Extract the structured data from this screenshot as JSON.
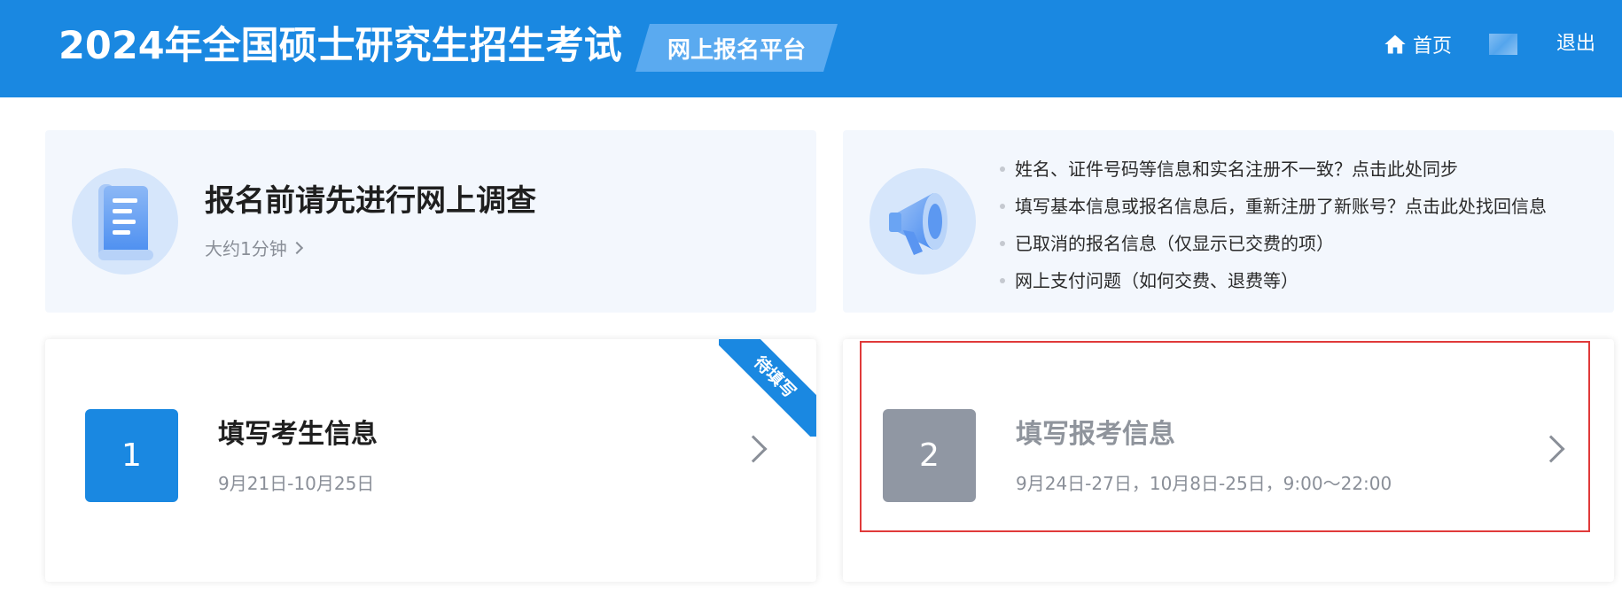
{
  "header": {
    "title": "2024年全国硕士研究生招生考试",
    "platform_badge": "网上报名平台",
    "nav_home": "首页",
    "nav_logout": "退出"
  },
  "survey_card": {
    "title": "报名前请先进行网上调查",
    "subtitle": "大约1分钟",
    "icon": "document-scroll-icon"
  },
  "info_card": {
    "icon": "megaphone-icon",
    "items": [
      "姓名、证件号码等信息和实名注册不一致？点击此处同步",
      "填写基本信息或报名信息后，重新注册了新账号？点击此处找回信息",
      "已取消的报名信息（仅显示已交费的项）",
      "网上支付问题（如何交费、退费等）"
    ]
  },
  "steps": [
    {
      "number": "1",
      "title": "填写考生信息",
      "date": "9月21日-10月25日",
      "ribbon": "待填写"
    },
    {
      "number": "2",
      "title": "填写报考信息",
      "date": "9月24日-27日，10月8日-25日，9:00～22:00"
    }
  ],
  "colors": {
    "header_bg": "#1a88e1",
    "badge_bg": "#5aaaf0",
    "card_bg": "#f3f7fd",
    "step_active": "#1a88e1",
    "step_inactive": "#9097a3",
    "highlight": "#e03a3a"
  }
}
